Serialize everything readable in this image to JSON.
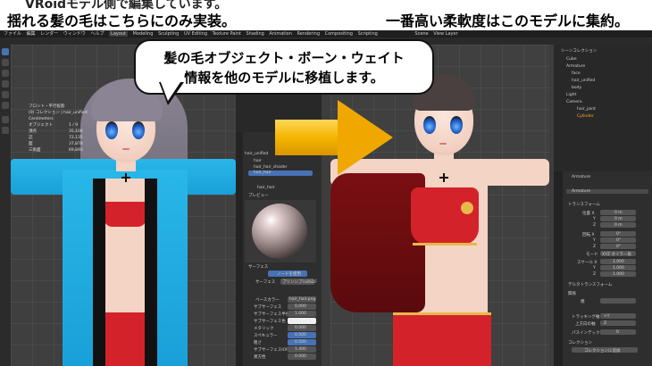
{
  "captions": {
    "left_top_partial": "VRoidモデル側で編集しています。",
    "left": "揺れる髪の毛はこちらにのみ実装。",
    "right": "一番高い柔軟度はこのモデルに集約。"
  },
  "bubble": {
    "line1": "髪の毛オブジェクト・ボーン・ウェイト",
    "line2": "情報を他のモデルに移植します。"
  },
  "blender": {
    "topbar_items": [
      "ファイル",
      "編集",
      "レンダー",
      "ウィンドウ",
      "ヘルプ",
      "Layout",
      "Modeling",
      "Sculpting",
      "UV Editing",
      "Texture Paint",
      "Shading",
      "Animation",
      "Rendering",
      "Compositing",
      "Scripting",
      "Scene",
      "View Layer"
    ],
    "stats": {
      "title": "フロント・平行投影",
      "collection": "(0) コレクション | hair_unified",
      "unit": "Centimeters",
      "rows": [
        {
          "label": "オブジェクト",
          "value": "1 / 9"
        },
        {
          "label": "頂点",
          "value": "35,100"
        },
        {
          "label": "辺",
          "value": "72,135"
        },
        {
          "label": "面",
          "value": "37,878"
        },
        {
          "label": "三角面",
          "value": "69,840"
        }
      ]
    },
    "mid_panel": {
      "object_name": "hair_unified",
      "items": [
        "hair",
        "hair_hair_shader",
        "hair_hair"
      ],
      "material": "hair_hair",
      "section_preview": "プレビュー",
      "section_surface": "サーフェス",
      "node_button": "ノードを使用",
      "surface_label": "サーフェス",
      "surface_value": "プリンシプルBSDF",
      "rows": [
        {
          "label": "ベースカラー",
          "value": "hair_hair.png"
        },
        {
          "label": "サブサーフェス",
          "value": "0.000"
        },
        {
          "label": "サブサーフェス半径",
          "value": "1.000"
        },
        {
          "label": "サブサーフェス色",
          "value": ""
        },
        {
          "label": "メタリック",
          "value": "0.000"
        },
        {
          "label": "スペキュラー",
          "value": "0.500"
        },
        {
          "label": "粗さ",
          "value": "0.500"
        },
        {
          "label": "サブサーフェスIOR",
          "value": "1.400"
        },
        {
          "label": "異方性",
          "value": "0.000"
        }
      ]
    },
    "right_outliner": {
      "title": "シーンコレクション",
      "items": [
        "Cube",
        "Armature",
        "face",
        "hair_unified",
        "body",
        "Light",
        "Camera",
        "hair_joint",
        "Cylinder"
      ]
    },
    "right_props": {
      "object": "Armature",
      "section_transform": "トランスフォーム",
      "rows": [
        {
          "label": "位置 X",
          "value": "0 m"
        },
        {
          "label": "Y",
          "value": "0 m"
        },
        {
          "label": "Z",
          "value": "0 m"
        },
        {
          "label": "回転 X",
          "value": "0°"
        },
        {
          "label": "Y",
          "value": "0°"
        },
        {
          "label": "Z",
          "value": "0°"
        },
        {
          "label": "モード",
          "value": "XYZ オイラー角"
        },
        {
          "label": "スケール X",
          "value": "1.000"
        },
        {
          "label": "Y",
          "value": "1.000"
        },
        {
          "label": "Z",
          "value": "1.000"
        }
      ],
      "section_delta": "デルタトランスフォーム",
      "section_relations": "関係",
      "parent_label": "親",
      "section_collections": "コレクション",
      "tracking_label": "トラッキング軸",
      "tracking_value": "+Y",
      "up_axis_label": "上方向の軸",
      "up_axis_value": "Z",
      "index_label": "パスインデックス",
      "index_value": "0",
      "collection_button": "コレクションに追加"
    }
  },
  "colors": {
    "arrow": "#f5b500",
    "jacket": "#29b6e8",
    "red_top": "#d4222a"
  }
}
